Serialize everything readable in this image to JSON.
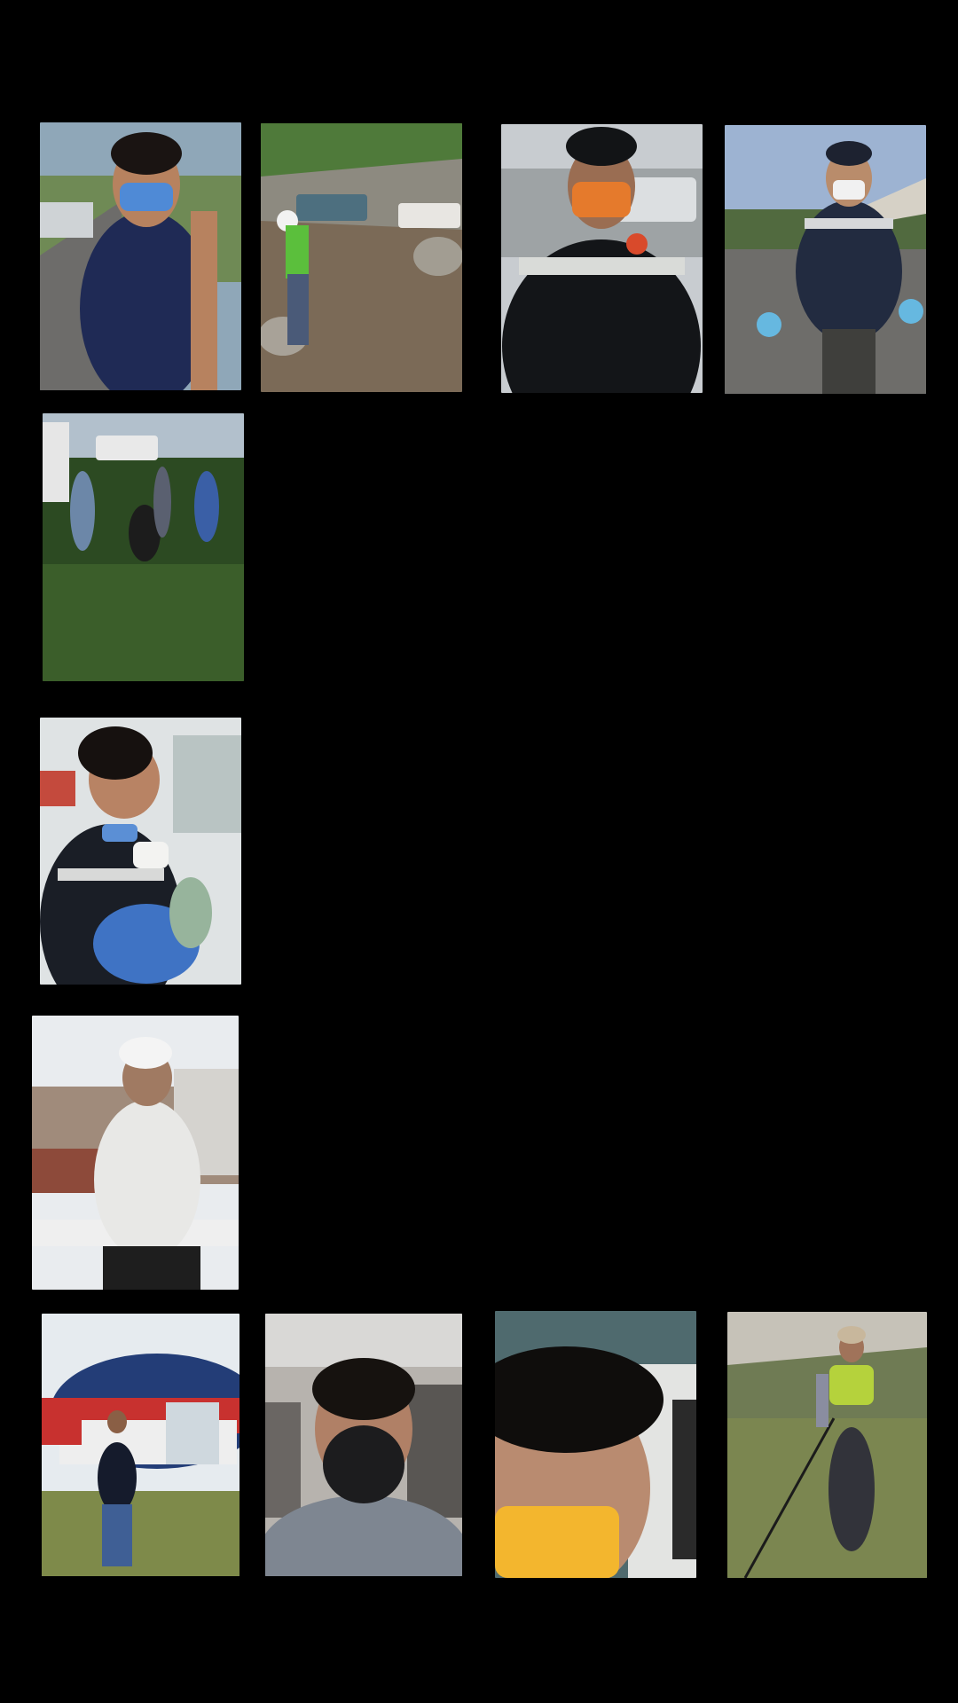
{
  "gallery": {
    "background": "#000000",
    "photos": [
      {
        "subject": "rescuer-blue-mask"
      },
      {
        "subject": "worker-rocky-slope"
      },
      {
        "subject": "rescuer-orange-mask"
      },
      {
        "subject": "rescuer-blue-gloves"
      },
      {
        "subject": "group-on-grass"
      },
      {
        "subject": "rescuer-holding-infant"
      },
      {
        "subject": "climber-white-helmet"
      },
      {
        "subject": "man-by-helicopter"
      },
      {
        "subject": "man-black-mask-car"
      },
      {
        "subject": "man-yellow-mask-closeup"
      },
      {
        "subject": "man-hill-rope"
      }
    ]
  }
}
